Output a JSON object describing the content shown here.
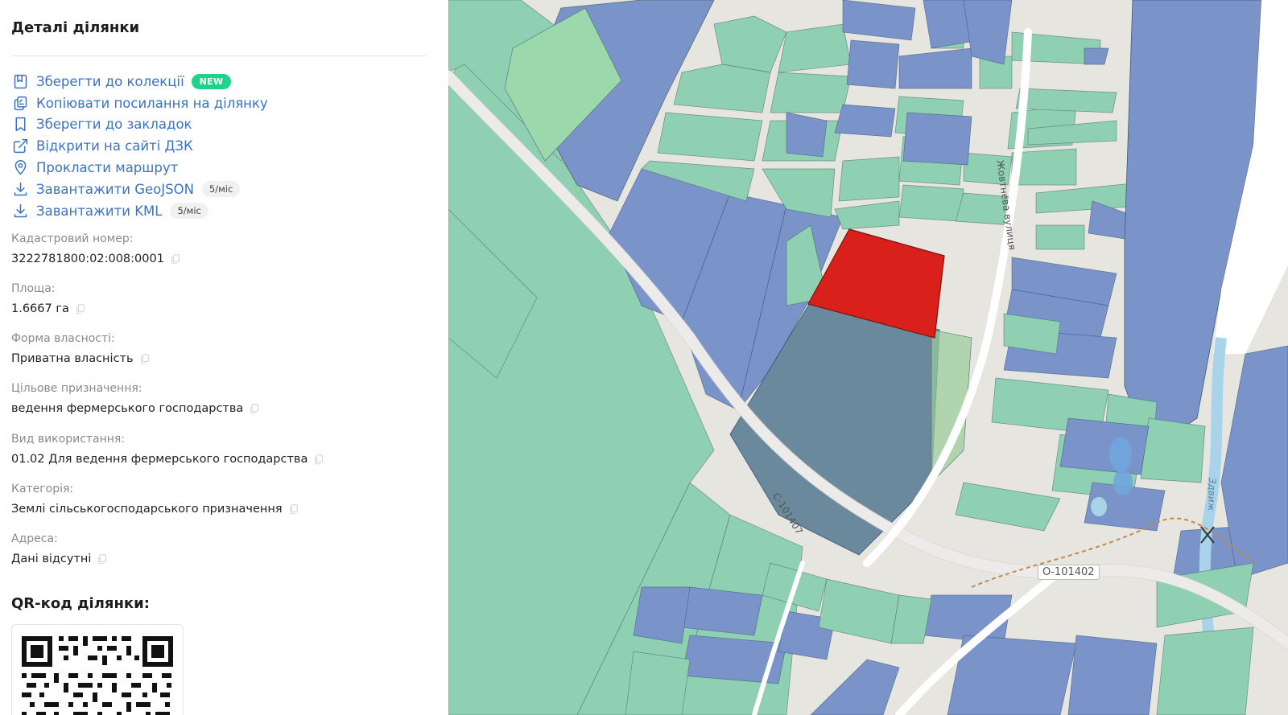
{
  "sidebar": {
    "title": "Деталі ділянки",
    "actions": [
      {
        "label": "Зберегти до колекції",
        "icon": "collection-save-icon",
        "badge": "NEW"
      },
      {
        "label": "Копіювати посилання на ділянку",
        "icon": "copy-link-icon"
      },
      {
        "label": "Зберегти до закладок",
        "icon": "bookmark-icon"
      },
      {
        "label": "Відкрити на сайті ДЗК",
        "icon": "external-link-icon"
      },
      {
        "label": "Прокласти маршрут",
        "icon": "location-pin-icon"
      },
      {
        "label": "Завантажити GeoJSON",
        "icon": "download-icon",
        "badge": "5/міс"
      },
      {
        "label": "Завантажити KML",
        "icon": "download-icon",
        "badge": "5/міс"
      }
    ],
    "fields": [
      {
        "label": "Кадастровий номер:",
        "value": "3222781800:02:008:0001"
      },
      {
        "label": "Площа:",
        "value": "1.6667 га"
      },
      {
        "label": "Форма власності:",
        "value": "Приватна власність"
      },
      {
        "label": "Цільове призначення:",
        "value": "ведення фермерського господарства"
      },
      {
        "label": "Вид використання:",
        "value": "01.02 Для ведення фермерського господарства"
      },
      {
        "label": "Категорія:",
        "value": "Землі сільськогосподарського призначення"
      },
      {
        "label": "Адреса:",
        "value": "Дані відсутні"
      }
    ],
    "qr_title": "QR-код ділянки:"
  },
  "map": {
    "labels": {
      "street": "Жовтнева вулиця",
      "road_c": "С-101407",
      "road_o": "О-101402",
      "river": "Здвиж"
    },
    "colors": {
      "parcel_green": "#8fcfb2",
      "parcel_blue": "#7a93c9",
      "selected_parcel": "#d9201a",
      "road": "#ffffff",
      "water": "#a9d3e8",
      "base": "#e7e5e0"
    }
  }
}
